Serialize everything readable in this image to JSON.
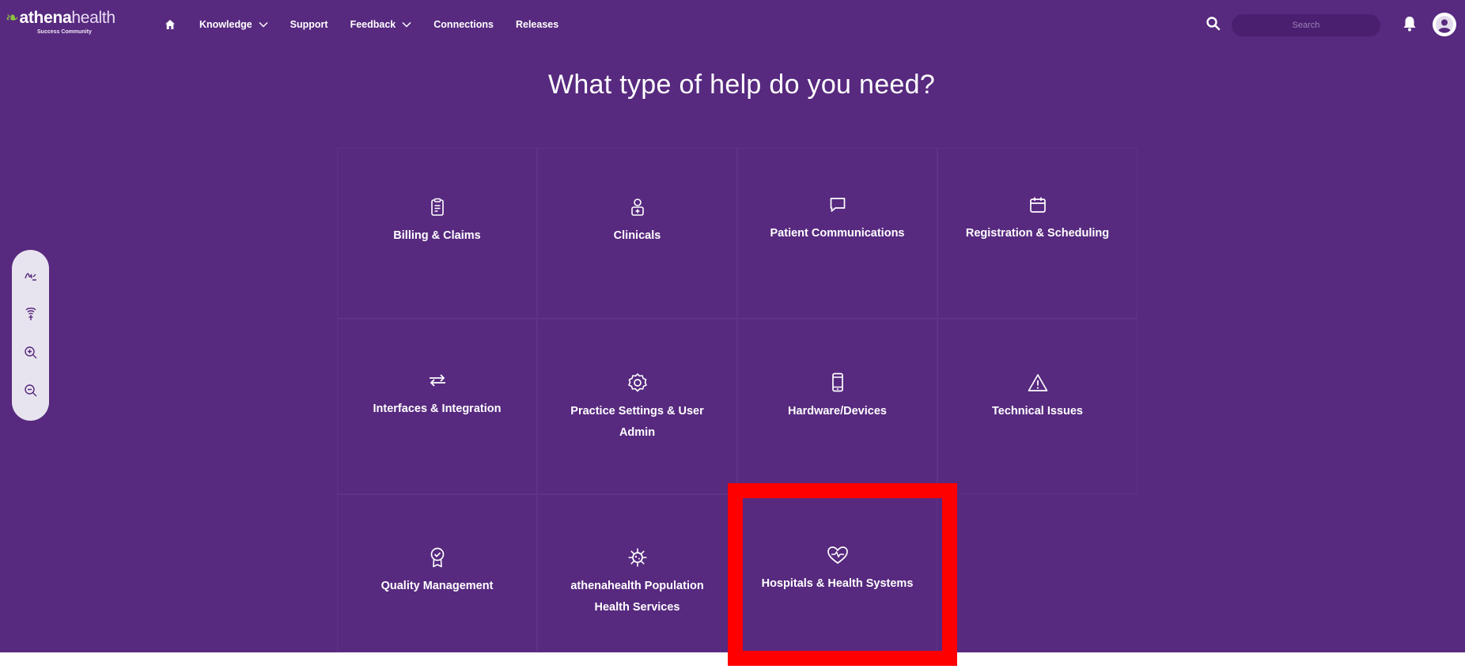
{
  "brand": {
    "leaf": "❧",
    "name_bold": "athena",
    "name_light": "health",
    "subtitle": "Success Community"
  },
  "nav": {
    "items": [
      {
        "label": "Knowledge",
        "has_dropdown": true
      },
      {
        "label": "Support",
        "has_dropdown": false
      },
      {
        "label": "Feedback",
        "has_dropdown": true
      },
      {
        "label": "Connections",
        "has_dropdown": false
      },
      {
        "label": "Releases",
        "has_dropdown": false
      }
    ]
  },
  "search": {
    "placeholder": "Search",
    "value": ""
  },
  "page": {
    "title": "What type of help do you need?"
  },
  "toolbar": {
    "tools": [
      "signature-icon",
      "hearing-icon",
      "zoom-in-icon",
      "zoom-out-icon"
    ]
  },
  "categories": [
    {
      "label": "Billing & Claims",
      "icon": "clipboard-icon"
    },
    {
      "label": "Clinicals",
      "icon": "doctor-icon"
    },
    {
      "label": "Patient Communications",
      "icon": "chat-icon"
    },
    {
      "label": "Registration & Scheduling",
      "icon": "calendar-icon"
    },
    {
      "label": "Interfaces & Integration",
      "icon": "arrows-icon"
    },
    {
      "label": "Practice Settings & User Admin",
      "icon": "gear-icon"
    },
    {
      "label": "Hardware/Devices",
      "icon": "mobile-device-icon"
    },
    {
      "label": "Technical Issues",
      "icon": "warning-icon"
    },
    {
      "label": "Quality Management",
      "icon": "award-icon"
    },
    {
      "label": "athenahealth Population Health Services",
      "icon": "virus-icon"
    },
    {
      "label": "Hospitals & Health Systems",
      "icon": "heart-pulse-icon"
    }
  ],
  "highlighted_category": "Hospitals & Health Systems",
  "colors": {
    "background": "#57297f",
    "brand_green": "#8cc63f",
    "highlight": "#ff0000",
    "toolbar_bg": "#e8e4ef"
  }
}
